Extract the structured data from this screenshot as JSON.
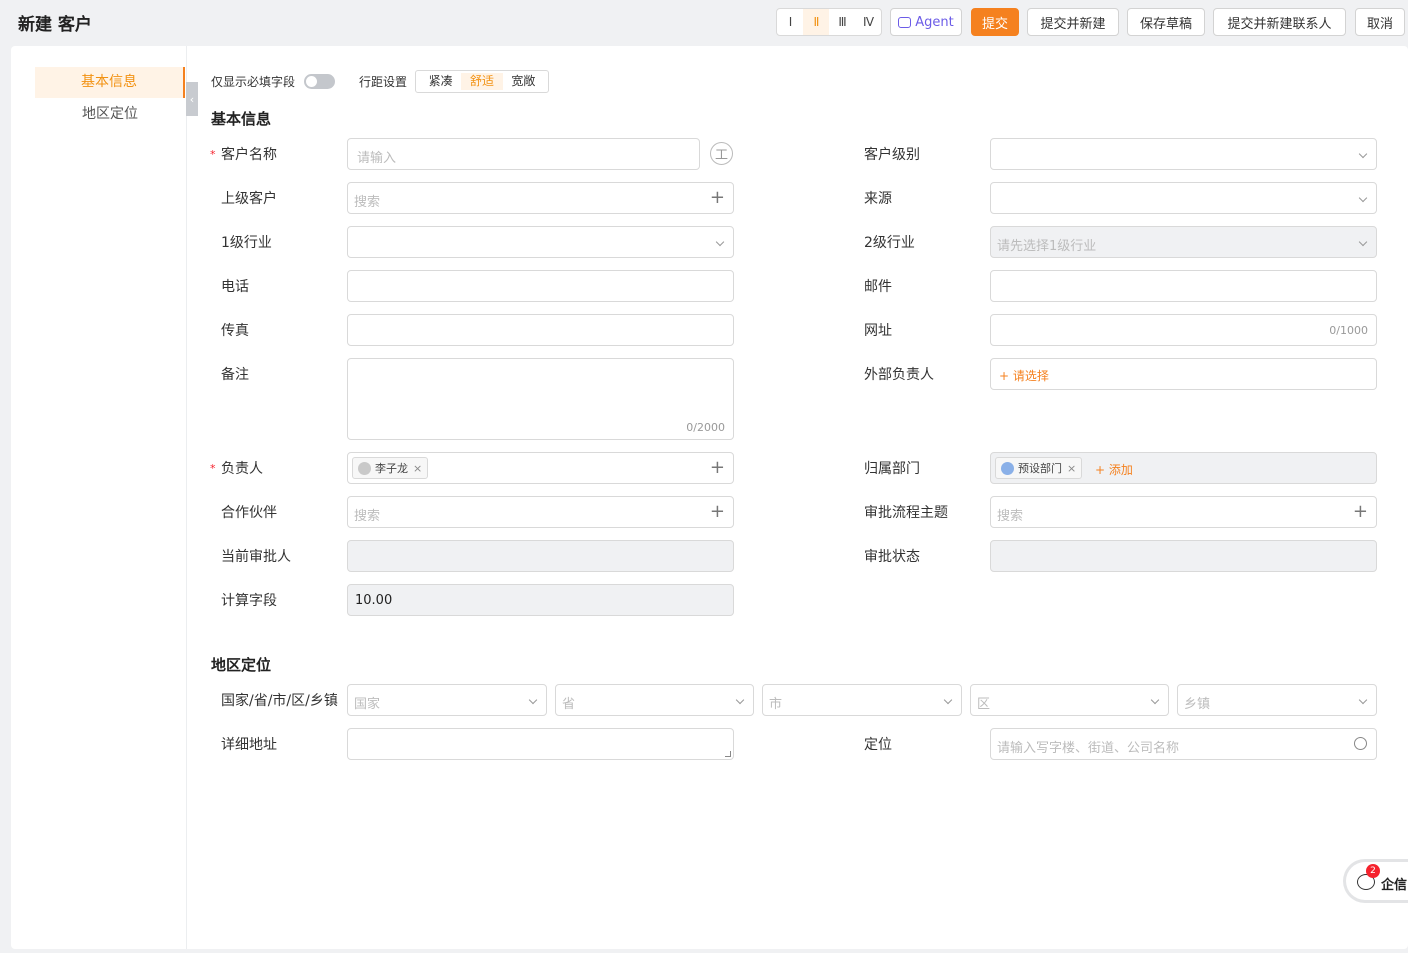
{
  "header": {
    "title": "新建 客户",
    "column_options": [
      "Ⅰ",
      "Ⅱ",
      "Ⅲ",
      "Ⅳ"
    ],
    "agent_label": "Agent",
    "submit_label": "提交",
    "submit_new_label": "提交并新建",
    "save_draft_label": "保存草稿",
    "submit_contact_label": "提交并新建联系人",
    "cancel_label": "取消"
  },
  "sidebar": {
    "items": [
      {
        "label": "基本信息",
        "active": true
      },
      {
        "label": "地区定位",
        "active": false
      }
    ]
  },
  "options": {
    "required_only_label": "仅显示必填字段",
    "required_only_on": false,
    "spacing_label": "行距设置",
    "spacing_options": [
      "紧凑",
      "舒适",
      "宽敞"
    ],
    "spacing_selected": "舒适"
  },
  "sections": {
    "basic": "基本信息",
    "region": "地区定位"
  },
  "fields": {
    "customer_name": {
      "label": "客户名称",
      "placeholder": "请输入",
      "required": true,
      "side_icon": "工"
    },
    "customer_level": {
      "label": "客户级别",
      "value": ""
    },
    "parent_customer": {
      "label": "上级客户",
      "placeholder": "搜索"
    },
    "source": {
      "label": "来源",
      "value": ""
    },
    "industry_l1": {
      "label": "1级行业",
      "value": ""
    },
    "industry_l2": {
      "label": "2级行业",
      "placeholder": "请先选择1级行业",
      "disabled": true
    },
    "phone": {
      "label": "电话",
      "value": ""
    },
    "email": {
      "label": "邮件",
      "value": ""
    },
    "fax": {
      "label": "传真",
      "value": ""
    },
    "website": {
      "label": "网址",
      "counter": "0/1000"
    },
    "remark": {
      "label": "备注",
      "counter": "0/2000"
    },
    "external_owner": {
      "label": "外部负责人",
      "action": "+ 请选择"
    },
    "owner": {
      "label": "负责人",
      "required": true,
      "tag": "李子龙",
      "tag_close": "×"
    },
    "department": {
      "label": "归属部门",
      "tag": "预设部门",
      "tag_close": "×",
      "action": "+ 添加"
    },
    "partner": {
      "label": "合作伙伴",
      "placeholder": "搜索"
    },
    "approval_subject": {
      "label": "审批流程主题",
      "placeholder": "搜索"
    },
    "current_approver": {
      "label": "当前审批人",
      "value": ""
    },
    "approval_status": {
      "label": "审批状态",
      "value": ""
    },
    "calc_field": {
      "label": "计算字段",
      "value": "10.00"
    },
    "region": {
      "label": "国家/省/市/区/乡镇",
      "placeholders": [
        "国家",
        "省",
        "市",
        "区",
        "乡镇"
      ]
    },
    "address": {
      "label": "详细地址",
      "value": ""
    },
    "location": {
      "label": "定位",
      "placeholder": "请输入写字楼、街道、公司名称"
    }
  },
  "floating": {
    "label": "企信",
    "badge": "2"
  },
  "colors": {
    "accent": "#f5811f",
    "accent_light": "#fff3e6",
    "required": "#f5222d"
  }
}
